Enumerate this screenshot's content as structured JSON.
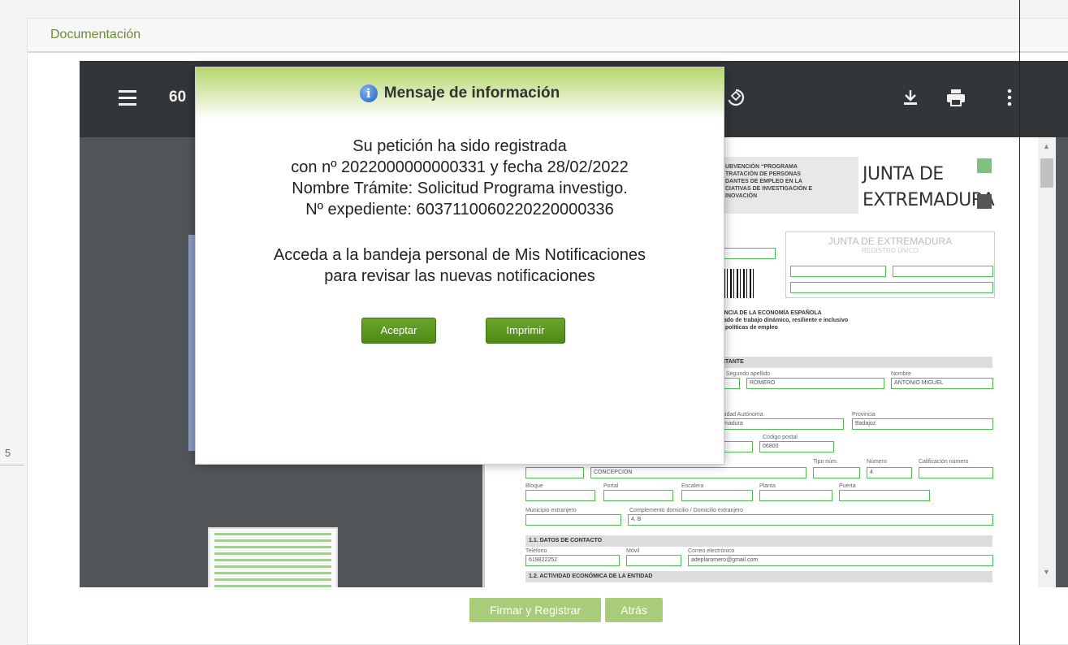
{
  "panel": {
    "title": "Documentación"
  },
  "left_mark": "5",
  "viewer": {
    "doc_title": "60",
    "icons": {
      "menu": "menu-icon",
      "rotate": "rotate-icon",
      "download": "download-icon",
      "print": "print-icon",
      "more": "more-vert-icon"
    }
  },
  "document": {
    "head_lines": [
      "UBVENCIÓN “PROGRAMA",
      "TRATACIÓN DE PERSONAS",
      "DANTES DE EMPLEO EN LA",
      "CIATIVAS DE INVESTIGACIÓN E",
      "INOVACIÓN"
    ],
    "brand_line1": "JUNTA DE",
    "brand_line2": "EXTREMADURA",
    "registry_title": "JUNTA DE EXTREMADURA",
    "registry_subtitle": "REGISTRO ÚNICO",
    "eco_lines": [
      "ENCIA DE LA ECONOMÍA ESPAÑOLA",
      "cado de trabajo dinámico, resiliente e inclusivo",
      "y políticas de empleo"
    ],
    "section_solicitante": "ITANTE",
    "label_segundo_apellido": "Segundo apellido",
    "value_segundo_apellido": "ROMERO",
    "label_nombre": "Nombre",
    "value_nombre": "ANTONIO MIGUEL",
    "label_comunidad": "nidad Autónoma",
    "value_comunidad": "madura",
    "label_provincia": "Provincia",
    "value_provincia": "Badajoz",
    "label_cp": "Código postal",
    "value_cp": "06800",
    "value_via": "CONCEPCION",
    "label_tipo_num": "Tipo núm.",
    "label_numero": "Número",
    "value_numero": "4",
    "label_calif": "Calificación número",
    "label_bloque": "Bloque",
    "label_portal": "Portal",
    "label_escalera": "Escalera",
    "label_planta": "Planta",
    "label_puerta": "Puerta",
    "label_municipio_ext": "Municipio extranjero",
    "label_complemento": "Complemento domicilio / Domicilio extranjero",
    "value_complemento": "4, B",
    "section_contacto": "1.1. DATOS DE CONTACTO",
    "label_telefono": "Teléfono",
    "value_telefono": "619822252",
    "label_movil": "Móvil",
    "label_correo": "Correo electrónico",
    "value_correo": "adeplaromero@gmail.com",
    "section_actividad": "1.2. ACTIVIDAD ECONÓMICA DE LA ENTIDAD"
  },
  "modal": {
    "title": "Mensaje de información",
    "icon": "info-icon",
    "line1": "Su petición ha sido registrada",
    "line2": "con nº 2022000000000331 y fecha 28/02/2022",
    "line3": "Nombre Trámite: Solicitud Programa investigo.",
    "line4": "Nº expediente: 6037110060220220000336",
    "line5": "Acceda a la bandeja personal de Mis Notificaciones",
    "line6": "para revisar las nuevas notificaciones",
    "accept_label": "Aceptar",
    "print_label": "Imprimir"
  },
  "actions": {
    "sign_label": "Firmar y Registrar",
    "back_label": "Atrás"
  },
  "colors": {
    "accent_green": "#6aa52a",
    "header_green": "#b3d66a",
    "field_green": "#4cbf4c",
    "title_green": "#6f8a37"
  }
}
